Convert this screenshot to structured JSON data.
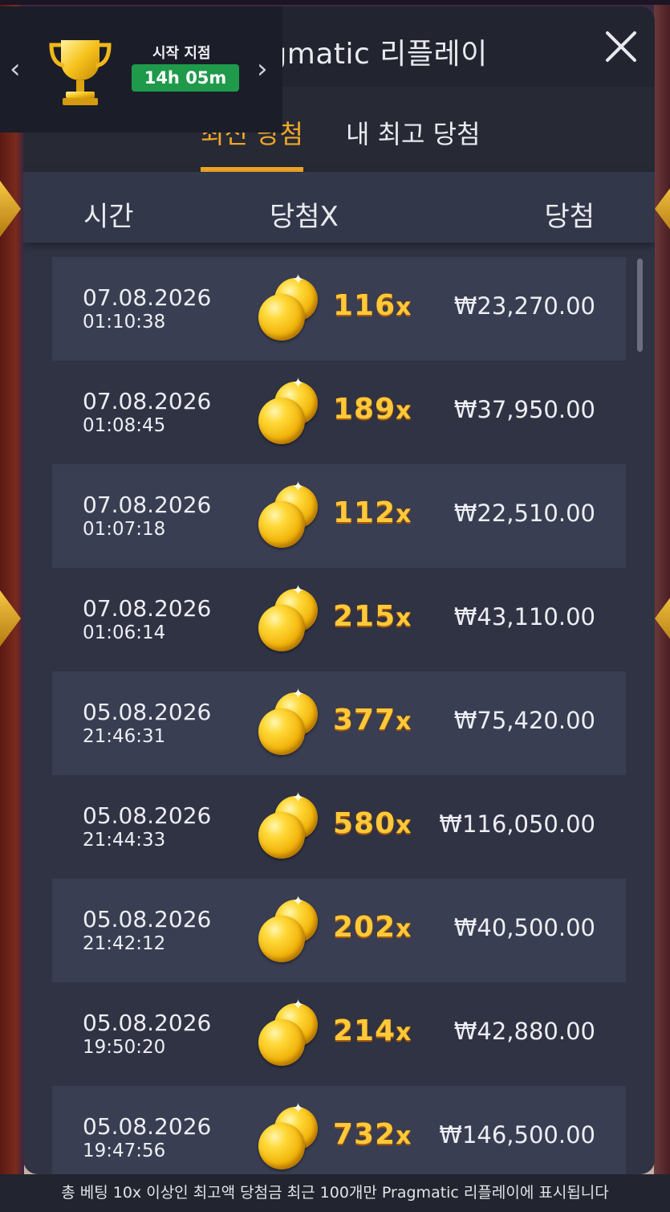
{
  "widget": {
    "label": "시작 지점",
    "timer": "14h 05m",
    "prev_icon": "‹",
    "next_icon": "›"
  },
  "modal": {
    "title": "Pragmatic 리플레이",
    "tabs": [
      {
        "label": "최신 당첨",
        "active": true
      },
      {
        "label": "내 최고 당첨",
        "active": false
      }
    ],
    "columns": {
      "time": "시간",
      "multiplier": "당첨X",
      "win": "당첨"
    },
    "rows": [
      {
        "date": "07.08.2026",
        "time": "01:10:38",
        "multiplier": "116",
        "mult_suffix": "x",
        "win": "₩23,270.00"
      },
      {
        "date": "07.08.2026",
        "time": "01:08:45",
        "multiplier": "189",
        "mult_suffix": "x",
        "win": "₩37,950.00"
      },
      {
        "date": "07.08.2026",
        "time": "01:07:18",
        "multiplier": "112",
        "mult_suffix": "x",
        "win": "₩22,510.00"
      },
      {
        "date": "07.08.2026",
        "time": "01:06:14",
        "multiplier": "215",
        "mult_suffix": "x",
        "win": "₩43,110.00"
      },
      {
        "date": "05.08.2026",
        "time": "21:46:31",
        "multiplier": "377",
        "mult_suffix": "x",
        "win": "₩75,420.00"
      },
      {
        "date": "05.08.2026",
        "time": "21:44:33",
        "multiplier": "580",
        "mult_suffix": "x",
        "win": "₩116,050.00"
      },
      {
        "date": "05.08.2026",
        "time": "21:42:12",
        "multiplier": "202",
        "mult_suffix": "x",
        "win": "₩40,500.00"
      },
      {
        "date": "05.08.2026",
        "time": "19:50:20",
        "multiplier": "214",
        "mult_suffix": "x",
        "win": "₩42,880.00"
      },
      {
        "date": "05.08.2026",
        "time": "19:47:56",
        "multiplier": "732",
        "mult_suffix": "x",
        "win": "₩146,500.00"
      }
    ],
    "footer": "총 베팅 10x 이상인 최고액 당첨금 최근 100개만 Pragmatic 리플레이에 표시됩니다"
  },
  "colors": {
    "accent": "#f0a728",
    "timer_bg": "#1f9a4a",
    "multiplier": "#ffc93a"
  },
  "icons": {
    "close": "close-icon",
    "trophy": "trophy-icon",
    "coins": "gold-coins-icon"
  }
}
